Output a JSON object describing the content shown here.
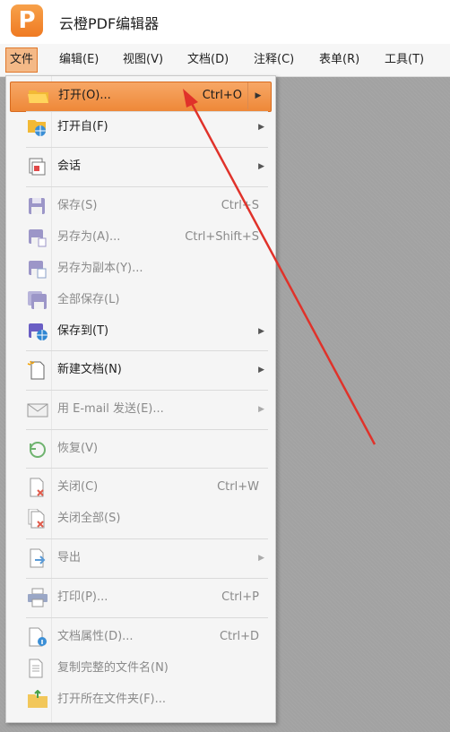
{
  "app": {
    "title": "云橙PDF编辑器",
    "logo_letter": "P"
  },
  "menubar": {
    "items": [
      {
        "label": "文件",
        "active": true
      },
      {
        "label": "编辑(E)"
      },
      {
        "label": "视图(V)"
      },
      {
        "label": "文档(D)"
      },
      {
        "label": "注释(C)"
      },
      {
        "label": "表单(R)"
      },
      {
        "label": "工具(T)"
      }
    ]
  },
  "file_menu": {
    "items": [
      {
        "label": "打开(O)...",
        "shortcut": "Ctrl+O",
        "submenu": true,
        "highlighted": true,
        "enabled": true,
        "icon": "folder-open-icon"
      },
      {
        "label": "打开自(F)",
        "shortcut": "",
        "submenu": true,
        "enabled": true,
        "icon": "folder-globe-icon"
      },
      {
        "label": "会话",
        "shortcut": "",
        "submenu": true,
        "enabled": true,
        "icon": "session-icon"
      },
      {
        "label": "保存(S)",
        "shortcut": "Ctrl+S",
        "submenu": false,
        "enabled": false,
        "icon": "save-icon"
      },
      {
        "label": "另存为(A)...",
        "shortcut": "Ctrl+Shift+S",
        "submenu": false,
        "enabled": false,
        "icon": "save-as-icon"
      },
      {
        "label": "另存为副本(Y)...",
        "shortcut": "",
        "submenu": false,
        "enabled": false,
        "icon": "save-copy-icon"
      },
      {
        "label": "全部保存(L)",
        "shortcut": "",
        "submenu": false,
        "enabled": false,
        "icon": "save-all-icon"
      },
      {
        "label": "保存到(T)",
        "shortcut": "",
        "submenu": true,
        "enabled": true,
        "icon": "save-to-icon"
      },
      {
        "label": "新建文档(N)",
        "shortcut": "",
        "submenu": true,
        "enabled": true,
        "icon": "new-document-icon"
      },
      {
        "label": "用 E-mail 发送(E)...",
        "shortcut": "",
        "submenu": true,
        "enabled": false,
        "icon": "email-icon"
      },
      {
        "label": "恢复(V)",
        "shortcut": "",
        "submenu": false,
        "enabled": false,
        "icon": "restore-icon"
      },
      {
        "label": "关闭(C)",
        "shortcut": "Ctrl+W",
        "submenu": false,
        "enabled": false,
        "icon": "close-document-icon"
      },
      {
        "label": "关闭全部(S)",
        "shortcut": "",
        "submenu": false,
        "enabled": false,
        "icon": "close-all-icon"
      },
      {
        "label": "导出",
        "shortcut": "",
        "submenu": true,
        "enabled": false,
        "icon": "export-icon"
      },
      {
        "label": "打印(P)...",
        "shortcut": "Ctrl+P",
        "submenu": false,
        "enabled": false,
        "icon": "print-icon"
      },
      {
        "label": "文档属性(D)...",
        "shortcut": "Ctrl+D",
        "submenu": false,
        "enabled": false,
        "icon": "document-properties-icon"
      },
      {
        "label": "复制完整的文件名(N)",
        "shortcut": "",
        "submenu": false,
        "enabled": false,
        "icon": "copy-filename-icon"
      },
      {
        "label": "打开所在文件夹(F)...",
        "shortcut": "",
        "submenu": false,
        "enabled": false,
        "icon": "open-folder-icon"
      }
    ]
  },
  "colors": {
    "accent": "#ee8838",
    "annotation_arrow": "#e0322a",
    "canvas": "#a4a4a4"
  }
}
